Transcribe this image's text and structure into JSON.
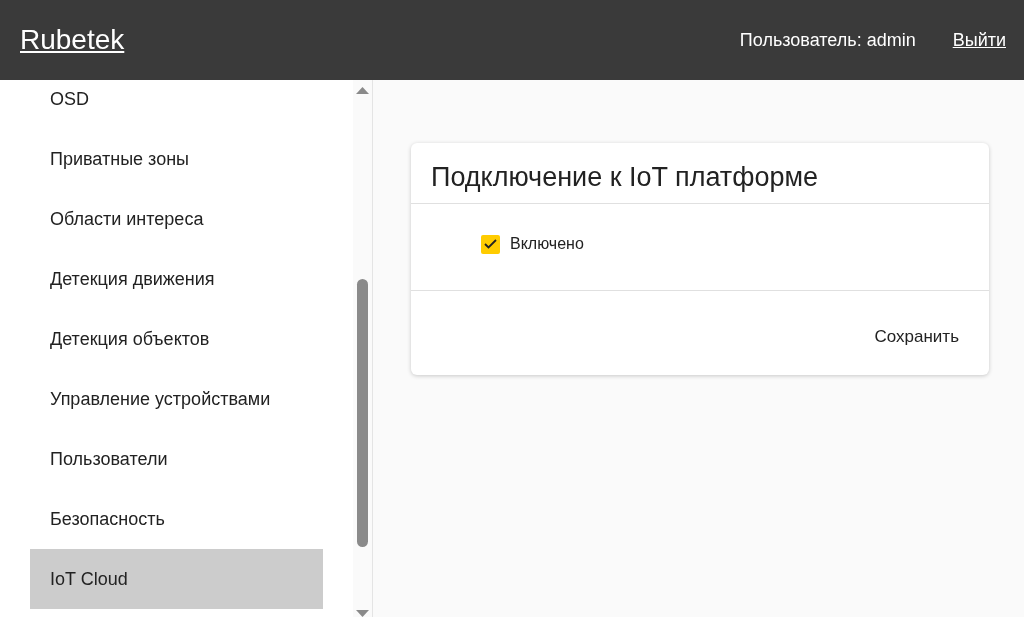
{
  "header": {
    "brand": "Rubetek",
    "user": "Пользователь: admin",
    "logout": "Выйти"
  },
  "sidebar": {
    "items": [
      {
        "label": "OSD",
        "selected": false
      },
      {
        "label": "Приватные зоны",
        "selected": false
      },
      {
        "label": "Области интереса",
        "selected": false
      },
      {
        "label": "Детекция движения",
        "selected": false
      },
      {
        "label": "Детекция объектов",
        "selected": false
      },
      {
        "label": "Управление устройствами",
        "selected": false
      },
      {
        "label": "Пользователи",
        "selected": false
      },
      {
        "label": "Безопасность",
        "selected": false
      },
      {
        "label": "IoT Cloud",
        "selected": true
      }
    ]
  },
  "card": {
    "title": "Подключение к IoT платформе",
    "checkbox": {
      "label": "Включено",
      "checked": true
    },
    "save": "Сохранить"
  }
}
